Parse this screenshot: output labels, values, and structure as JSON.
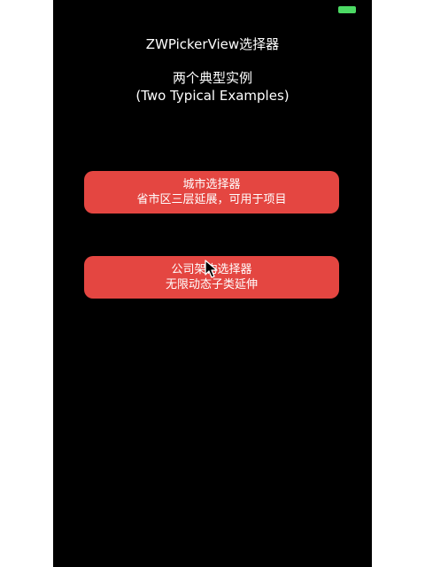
{
  "colors": {
    "background": "#000000",
    "button": "#e44641",
    "battery": "#4cd964",
    "text": "#ffffff"
  },
  "header": {
    "title": "ZWPickerView选择器",
    "subtitle_cn": "两个典型实例",
    "subtitle_en": "(Two Typical Examples)"
  },
  "buttons": [
    {
      "line1": "城市选择器",
      "line2": "省市区三层延展，可用于项目"
    },
    {
      "line1": "公司架构选择器",
      "line2": "无限动态子类延伸"
    }
  ],
  "icons": {
    "battery": "battery-icon",
    "cursor": "mouse-pointer-icon"
  }
}
